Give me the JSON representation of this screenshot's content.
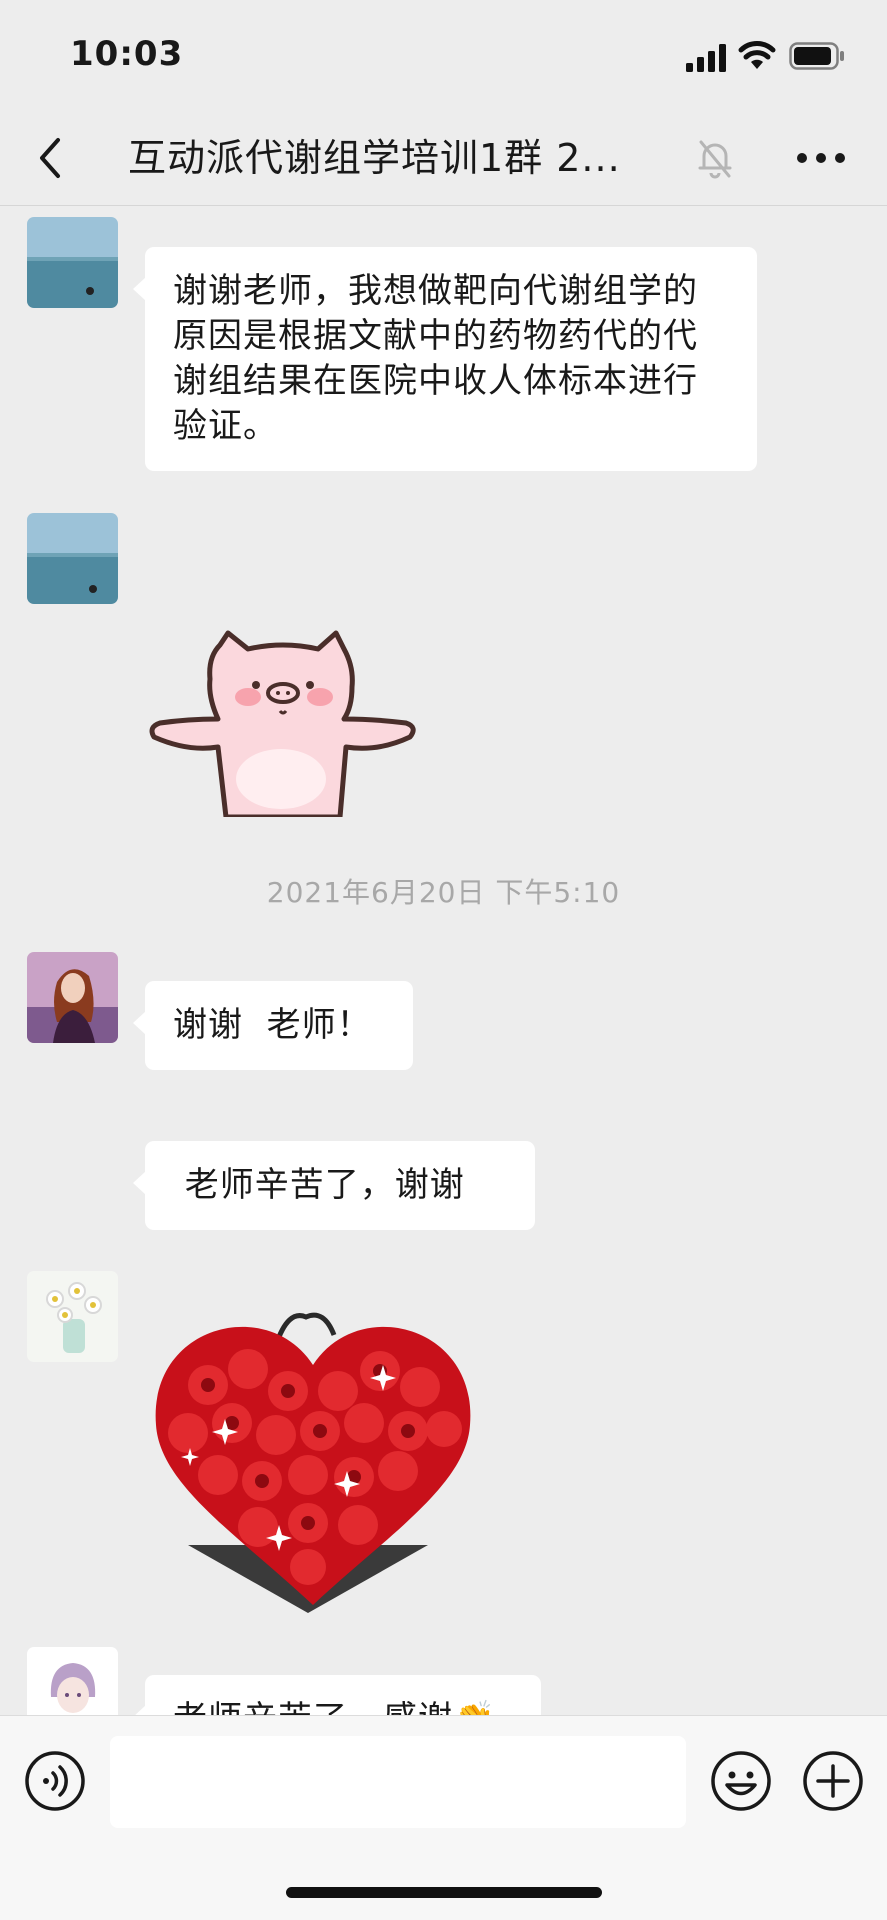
{
  "status_bar": {
    "time": "10:03"
  },
  "nav": {
    "title": "互动派代谢组学培训1群 2..."
  },
  "messages": [
    {
      "type": "text",
      "text": "谢谢老师，我想做靶向代谢组学的原因是根据文献中的药物药代的代谢组结果在医院中收人体标本进行验证。"
    },
    {
      "type": "sticker",
      "sticker": "pink-pig"
    },
    {
      "type": "timestamp",
      "text": "2021年6月20日 下午5:10"
    },
    {
      "type": "text",
      "text": "谢谢  老师！"
    },
    {
      "type": "text",
      "text": " 老师辛苦了，谢谢"
    },
    {
      "type": "sticker",
      "sticker": "red-rose-heart"
    },
    {
      "type": "text",
      "text": "老师辛苦了，感谢👏"
    }
  ],
  "colors": {
    "background": "#ededed",
    "bubble": "#ffffff",
    "timestamp": "#a8a8a8"
  },
  "input": {
    "placeholder": ""
  },
  "icons": [
    "back-icon",
    "mute-icon",
    "more-icon",
    "voice-icon",
    "emoji-icon",
    "plus-icon"
  ]
}
